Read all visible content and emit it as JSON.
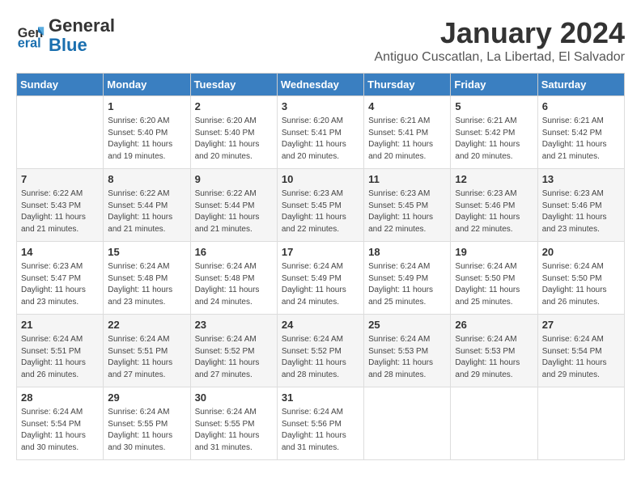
{
  "logo": {
    "line1": "General",
    "line2": "Blue"
  },
  "title": "January 2024",
  "location": "Antiguo Cuscatlan, La Libertad, El Salvador",
  "days_of_week": [
    "Sunday",
    "Monday",
    "Tuesday",
    "Wednesday",
    "Thursday",
    "Friday",
    "Saturday"
  ],
  "weeks": [
    [
      {
        "day": "",
        "info": ""
      },
      {
        "day": "1",
        "info": "Sunrise: 6:20 AM\nSunset: 5:40 PM\nDaylight: 11 hours\nand 19 minutes."
      },
      {
        "day": "2",
        "info": "Sunrise: 6:20 AM\nSunset: 5:40 PM\nDaylight: 11 hours\nand 20 minutes."
      },
      {
        "day": "3",
        "info": "Sunrise: 6:20 AM\nSunset: 5:41 PM\nDaylight: 11 hours\nand 20 minutes."
      },
      {
        "day": "4",
        "info": "Sunrise: 6:21 AM\nSunset: 5:41 PM\nDaylight: 11 hours\nand 20 minutes."
      },
      {
        "day": "5",
        "info": "Sunrise: 6:21 AM\nSunset: 5:42 PM\nDaylight: 11 hours\nand 20 minutes."
      },
      {
        "day": "6",
        "info": "Sunrise: 6:21 AM\nSunset: 5:42 PM\nDaylight: 11 hours\nand 21 minutes."
      }
    ],
    [
      {
        "day": "7",
        "info": "Sunrise: 6:22 AM\nSunset: 5:43 PM\nDaylight: 11 hours\nand 21 minutes."
      },
      {
        "day": "8",
        "info": "Sunrise: 6:22 AM\nSunset: 5:44 PM\nDaylight: 11 hours\nand 21 minutes."
      },
      {
        "day": "9",
        "info": "Sunrise: 6:22 AM\nSunset: 5:44 PM\nDaylight: 11 hours\nand 21 minutes."
      },
      {
        "day": "10",
        "info": "Sunrise: 6:23 AM\nSunset: 5:45 PM\nDaylight: 11 hours\nand 22 minutes."
      },
      {
        "day": "11",
        "info": "Sunrise: 6:23 AM\nSunset: 5:45 PM\nDaylight: 11 hours\nand 22 minutes."
      },
      {
        "day": "12",
        "info": "Sunrise: 6:23 AM\nSunset: 5:46 PM\nDaylight: 11 hours\nand 22 minutes."
      },
      {
        "day": "13",
        "info": "Sunrise: 6:23 AM\nSunset: 5:46 PM\nDaylight: 11 hours\nand 23 minutes."
      }
    ],
    [
      {
        "day": "14",
        "info": "Sunrise: 6:23 AM\nSunset: 5:47 PM\nDaylight: 11 hours\nand 23 minutes."
      },
      {
        "day": "15",
        "info": "Sunrise: 6:24 AM\nSunset: 5:48 PM\nDaylight: 11 hours\nand 23 minutes."
      },
      {
        "day": "16",
        "info": "Sunrise: 6:24 AM\nSunset: 5:48 PM\nDaylight: 11 hours\nand 24 minutes."
      },
      {
        "day": "17",
        "info": "Sunrise: 6:24 AM\nSunset: 5:49 PM\nDaylight: 11 hours\nand 24 minutes."
      },
      {
        "day": "18",
        "info": "Sunrise: 6:24 AM\nSunset: 5:49 PM\nDaylight: 11 hours\nand 25 minutes."
      },
      {
        "day": "19",
        "info": "Sunrise: 6:24 AM\nSunset: 5:50 PM\nDaylight: 11 hours\nand 25 minutes."
      },
      {
        "day": "20",
        "info": "Sunrise: 6:24 AM\nSunset: 5:50 PM\nDaylight: 11 hours\nand 26 minutes."
      }
    ],
    [
      {
        "day": "21",
        "info": "Sunrise: 6:24 AM\nSunset: 5:51 PM\nDaylight: 11 hours\nand 26 minutes."
      },
      {
        "day": "22",
        "info": "Sunrise: 6:24 AM\nSunset: 5:51 PM\nDaylight: 11 hours\nand 27 minutes."
      },
      {
        "day": "23",
        "info": "Sunrise: 6:24 AM\nSunset: 5:52 PM\nDaylight: 11 hours\nand 27 minutes."
      },
      {
        "day": "24",
        "info": "Sunrise: 6:24 AM\nSunset: 5:52 PM\nDaylight: 11 hours\nand 28 minutes."
      },
      {
        "day": "25",
        "info": "Sunrise: 6:24 AM\nSunset: 5:53 PM\nDaylight: 11 hours\nand 28 minutes."
      },
      {
        "day": "26",
        "info": "Sunrise: 6:24 AM\nSunset: 5:53 PM\nDaylight: 11 hours\nand 29 minutes."
      },
      {
        "day": "27",
        "info": "Sunrise: 6:24 AM\nSunset: 5:54 PM\nDaylight: 11 hours\nand 29 minutes."
      }
    ],
    [
      {
        "day": "28",
        "info": "Sunrise: 6:24 AM\nSunset: 5:54 PM\nDaylight: 11 hours\nand 30 minutes."
      },
      {
        "day": "29",
        "info": "Sunrise: 6:24 AM\nSunset: 5:55 PM\nDaylight: 11 hours\nand 30 minutes."
      },
      {
        "day": "30",
        "info": "Sunrise: 6:24 AM\nSunset: 5:55 PM\nDaylight: 11 hours\nand 31 minutes."
      },
      {
        "day": "31",
        "info": "Sunrise: 6:24 AM\nSunset: 5:56 PM\nDaylight: 11 hours\nand 31 minutes."
      },
      {
        "day": "",
        "info": ""
      },
      {
        "day": "",
        "info": ""
      },
      {
        "day": "",
        "info": ""
      }
    ]
  ]
}
